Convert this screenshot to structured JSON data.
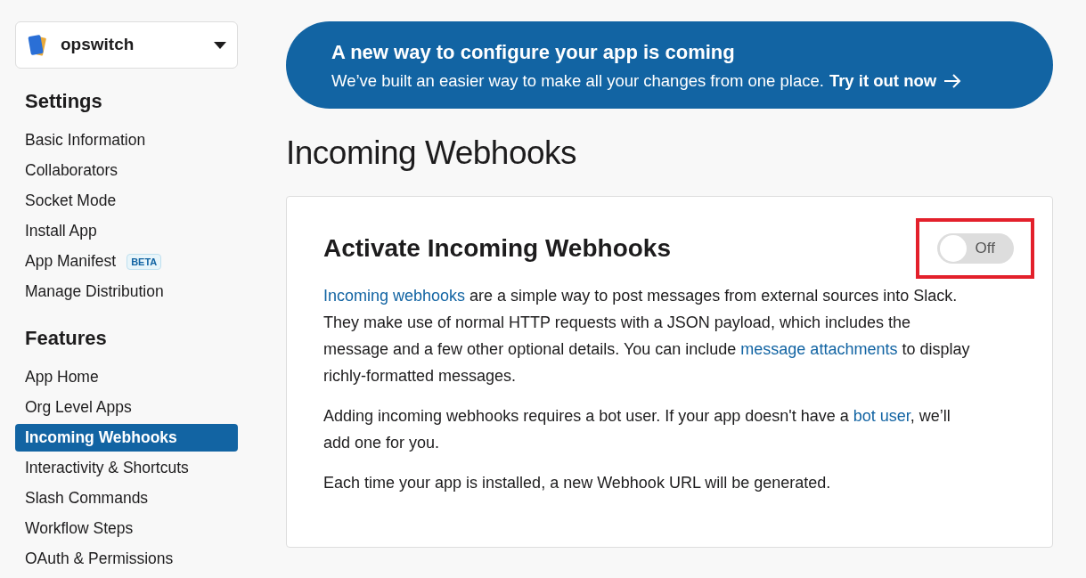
{
  "app_switcher": {
    "name": "opswitch"
  },
  "sidebar": {
    "sections": [
      {
        "title": "Settings",
        "items": [
          {
            "label": "Basic Information",
            "selected": false
          },
          {
            "label": "Collaborators",
            "selected": false
          },
          {
            "label": "Socket Mode",
            "selected": false
          },
          {
            "label": "Install App",
            "selected": false
          },
          {
            "label": "App Manifest",
            "badge": "BETA",
            "selected": false
          },
          {
            "label": "Manage Distribution",
            "selected": false
          }
        ]
      },
      {
        "title": "Features",
        "items": [
          {
            "label": "App Home",
            "selected": false
          },
          {
            "label": "Org Level Apps",
            "selected": false
          },
          {
            "label": "Incoming Webhooks",
            "selected": true
          },
          {
            "label": "Interactivity & Shortcuts",
            "selected": false
          },
          {
            "label": "Slash Commands",
            "selected": false
          },
          {
            "label": "Workflow Steps",
            "selected": false
          },
          {
            "label": "OAuth & Permissions",
            "selected": false
          }
        ]
      }
    ]
  },
  "banner": {
    "title": "A new way to configure your app is coming",
    "text": "We’ve built an easier way to make all your changes from one place.",
    "link": "Try it out now"
  },
  "page_title": "Incoming Webhooks",
  "card": {
    "title": "Activate Incoming Webhooks",
    "toggle": {
      "on": false,
      "label": "Off",
      "highlighted": true
    },
    "paragraphs": [
      [
        {
          "kind": "link",
          "text": "Incoming webhooks"
        },
        {
          "kind": "text",
          "text": " are a simple way to post messages from external sources into Slack. They make use of normal HTTP requests with a JSON payload, which includes the message and a few other optional details. You can include "
        },
        {
          "kind": "link",
          "text": "message attachments"
        },
        {
          "kind": "text",
          "text": " to display richly-formatted messages."
        }
      ],
      [
        {
          "kind": "text",
          "text": "Adding incoming webhooks requires a bot user. If your app doesn't have a "
        },
        {
          "kind": "link",
          "text": "bot user"
        },
        {
          "kind": "text",
          "text": ", we’ll add one for you."
        }
      ],
      [
        {
          "kind": "text",
          "text": "Each time your app is installed, a new Webhook URL will be generated."
        }
      ]
    ]
  }
}
